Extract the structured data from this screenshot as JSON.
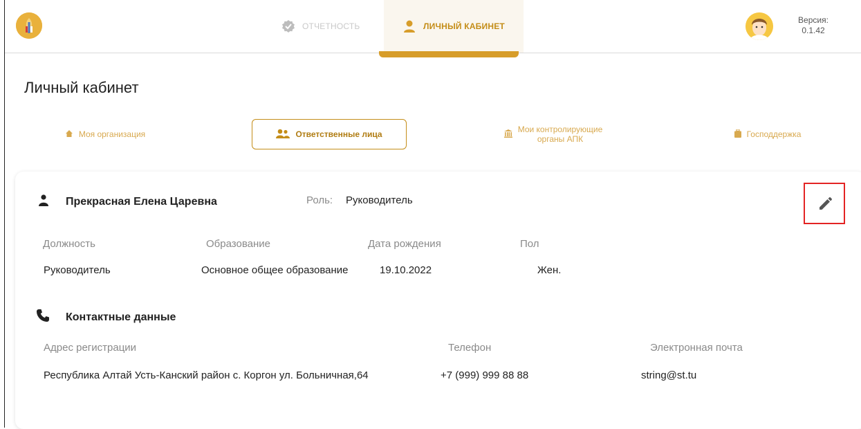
{
  "header": {
    "nav": [
      {
        "label": "ОТЧЕТНОСТЬ"
      },
      {
        "label": "ЛИЧНЫЙ КАБИНЕТ"
      }
    ],
    "version_label": "Версия:",
    "version_value": "0.1.42"
  },
  "page": {
    "title": "Личный кабинет",
    "subtabs": [
      {
        "label": "Моя организация"
      },
      {
        "label": "Ответственные лица"
      },
      {
        "label_line1": "Мои контролирующие",
        "label_line2": "органы АПК"
      },
      {
        "label": "Господдержка"
      }
    ]
  },
  "person": {
    "name": "Прекрасная Елена Царевна",
    "role_label": "Роль:",
    "role_value": "Руководитель",
    "fields": [
      {
        "label": "Должность",
        "value": "Руководитель"
      },
      {
        "label": "Образование",
        "value": "Основное общее образование"
      },
      {
        "label": "Дата рождения",
        "value": "19.10.2022"
      },
      {
        "label": "Пол",
        "value": "Жен."
      }
    ]
  },
  "contacts": {
    "title": "Контактные данные",
    "fields": [
      {
        "label": "Адрес регистрации",
        "value": "Республика Алтай Усть-Канский район с. Коргон ул. Больничная,64"
      },
      {
        "label": "Телефон",
        "value": "+7 (999) 999 88 88"
      },
      {
        "label": "Электронная почта",
        "value": "string@st.tu"
      }
    ]
  },
  "colors": {
    "accent": "#d79d2a",
    "accent_dark": "#b07c12",
    "highlight_box": "#e32323"
  },
  "icons": [
    "logo-icon",
    "verified-icon",
    "user-icon",
    "home-icon",
    "users-icon",
    "bank-icon",
    "briefcase-icon",
    "person-icon",
    "pencil-icon",
    "phone-icon",
    "avatar-icon"
  ]
}
